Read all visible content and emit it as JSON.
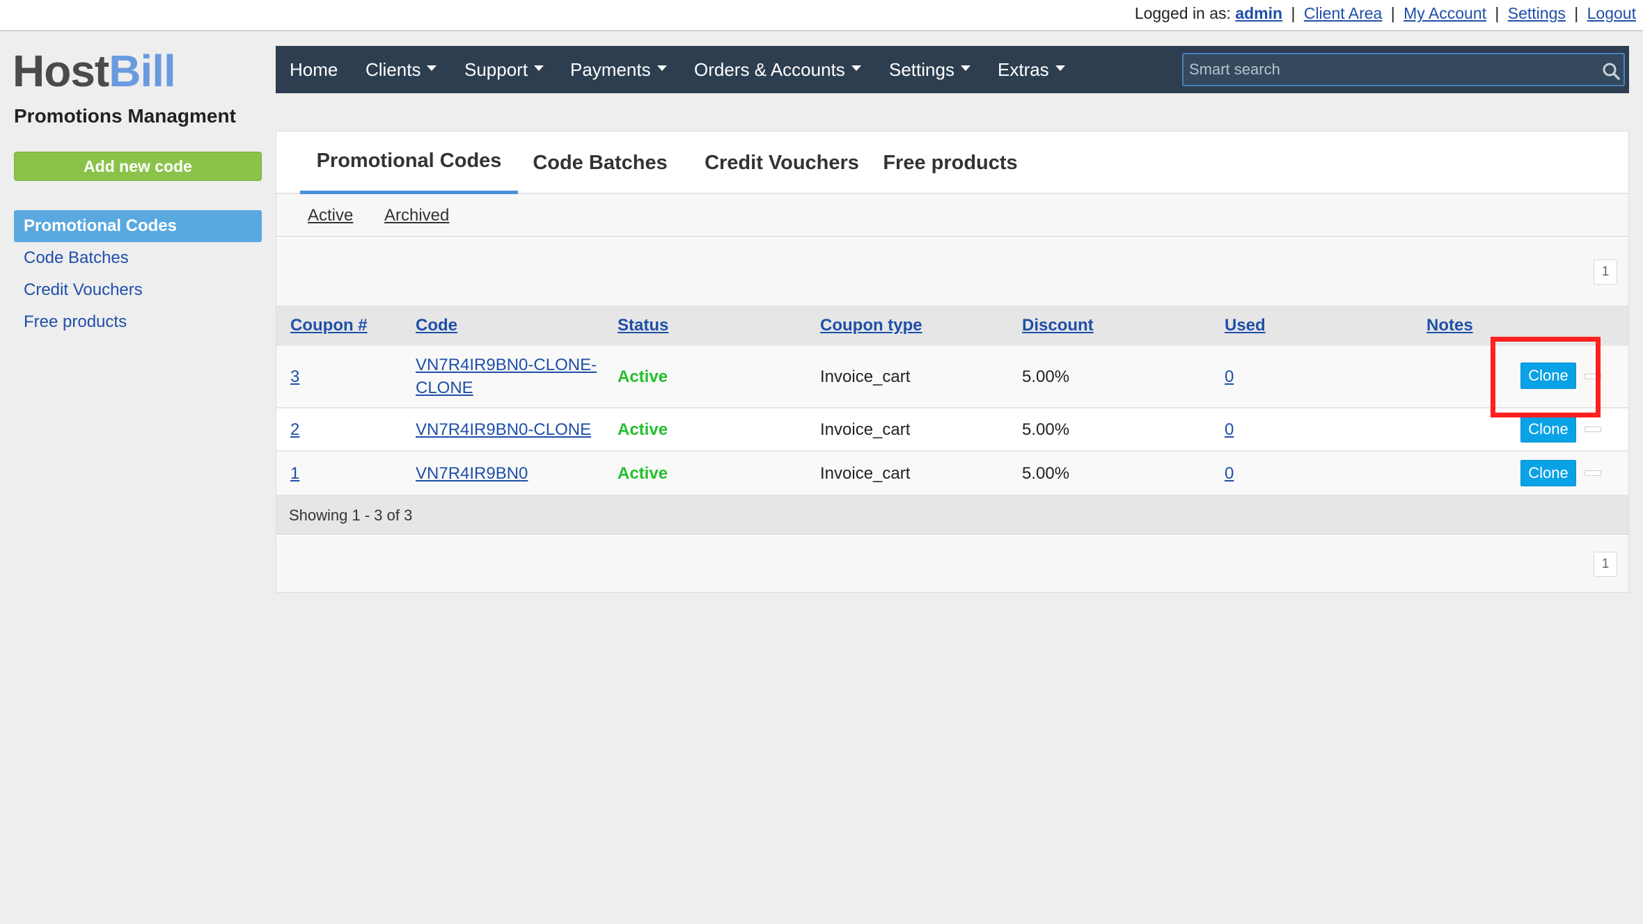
{
  "topbar": {
    "logged_in_label": "Logged in as:",
    "user": "admin",
    "links": [
      "Client Area",
      "My Account",
      "Settings",
      "Logout"
    ]
  },
  "logo": {
    "part1": "Host",
    "part2": "Bill"
  },
  "page": {
    "title": "Promotions Managment",
    "add_button": "Add new code"
  },
  "sidebar": {
    "items": [
      {
        "label": "Promotional Codes",
        "active": true
      },
      {
        "label": "Code Batches",
        "active": false
      },
      {
        "label": "Credit Vouchers",
        "active": false
      },
      {
        "label": "Free products",
        "active": false
      }
    ]
  },
  "nav": {
    "items": [
      "Home",
      "Clients",
      "Support",
      "Payments",
      "Orders & Accounts",
      "Settings",
      "Extras"
    ],
    "search_placeholder": "Smart search"
  },
  "tabs": [
    "Promotional Codes",
    "Code Batches",
    "Credit Vouchers",
    "Free products"
  ],
  "subtabs": [
    "Active",
    "Archived"
  ],
  "pager": {
    "page": "1"
  },
  "table": {
    "headers": [
      "Coupon #",
      "Code",
      "Status",
      "Coupon type",
      "Discount",
      "Used",
      "Notes"
    ],
    "rows": [
      {
        "id": "3",
        "code": "VN7R4IR9BN0-CLONE-CLONE",
        "status": "Active",
        "type": "Invoice_cart",
        "discount": "5.00%",
        "used": "0",
        "action": "Clone"
      },
      {
        "id": "2",
        "code": "VN7R4IR9BN0-CLONE",
        "status": "Active",
        "type": "Invoice_cart",
        "discount": "5.00%",
        "used": "0",
        "action": "Clone"
      },
      {
        "id": "1",
        "code": "VN7R4IR9BN0",
        "status": "Active",
        "type": "Invoice_cart",
        "discount": "5.00%",
        "used": "0",
        "action": "Clone"
      }
    ],
    "showing": "Showing 1 - 3 of 3"
  },
  "colors": {
    "nav_bg": "#2d3e50",
    "accent_blue": "#5aa8e0",
    "add_green": "#8bc34a",
    "status_green": "#22c02b",
    "clone_blue": "#0aa2e6",
    "highlight_red": "#ff2020"
  }
}
